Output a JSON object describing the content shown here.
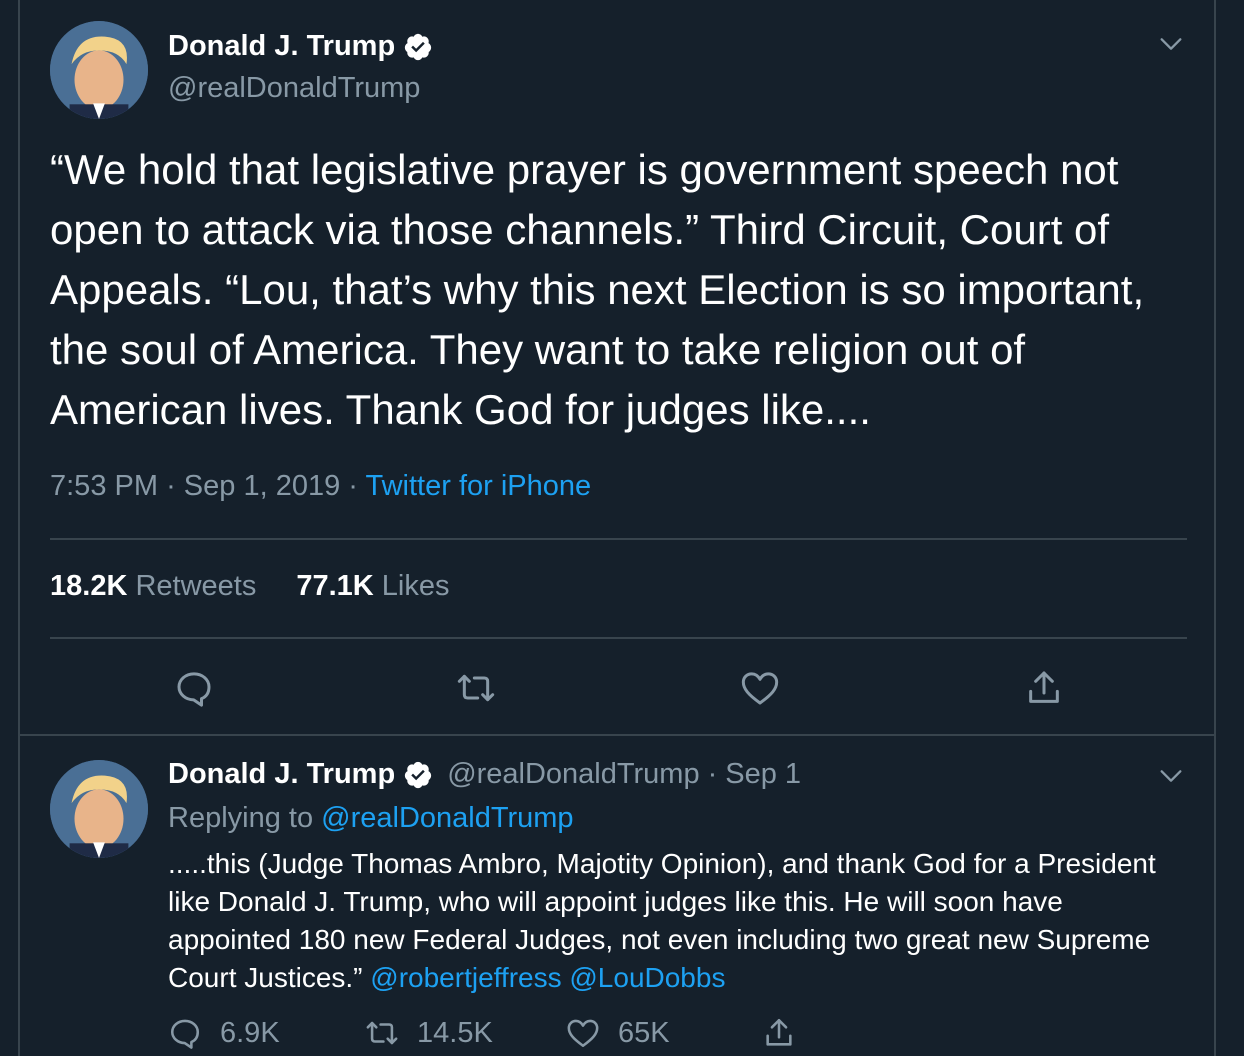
{
  "colors": {
    "background": "#15202b",
    "border": "#38444d",
    "muted_text": "#8899a6",
    "link": "#1da1f2",
    "verified_badge": "#ffffff"
  },
  "main_tweet": {
    "author": {
      "display_name": "Donald J. Trump",
      "handle": "@realDonaldTrump",
      "verified": true,
      "avatar_icon": "profile-photo"
    },
    "text": "“We hold that legislative prayer is government speech not open to attack via those channels.” Third Circuit, Court of Appeals. “Lou, that’s why this next Election is so important, the soul of America. They want to take religion out of American lives. Thank God for judges like....",
    "time": "7:53 PM",
    "date": "Sep 1, 2019",
    "separator": "·",
    "source": "Twitter for iPhone",
    "retweets_count": "18.2K",
    "retweets_label": "Retweets",
    "likes_count": "77.1K",
    "likes_label": "Likes",
    "actions": [
      "reply-icon",
      "retweet-icon",
      "like-icon",
      "share-icon"
    ],
    "menu_icon": "chevron-down-icon"
  },
  "reply_tweet": {
    "author": {
      "display_name": "Donald J. Trump",
      "handle": "@realDonaldTrump",
      "verified": true,
      "avatar_icon": "profile-photo"
    },
    "separator": "·",
    "date": "Sep 1",
    "replying_prefix": "Replying to",
    "replying_to": "@realDonaldTrump",
    "text": ".....this (Judge Thomas Ambro, Majotity Opinion), and thank God for a President like Donald J. Trump, who will appoint judges like this. He will soon have appointed 180 new Federal Judges, not even including two great new Supreme Court Justices.”",
    "mentions": [
      "@robertjeffress",
      "@LouDobbs"
    ],
    "replies_count": "6.9K",
    "retweets_count": "14.5K",
    "likes_count": "65K",
    "menu_icon": "chevron-down-icon"
  }
}
